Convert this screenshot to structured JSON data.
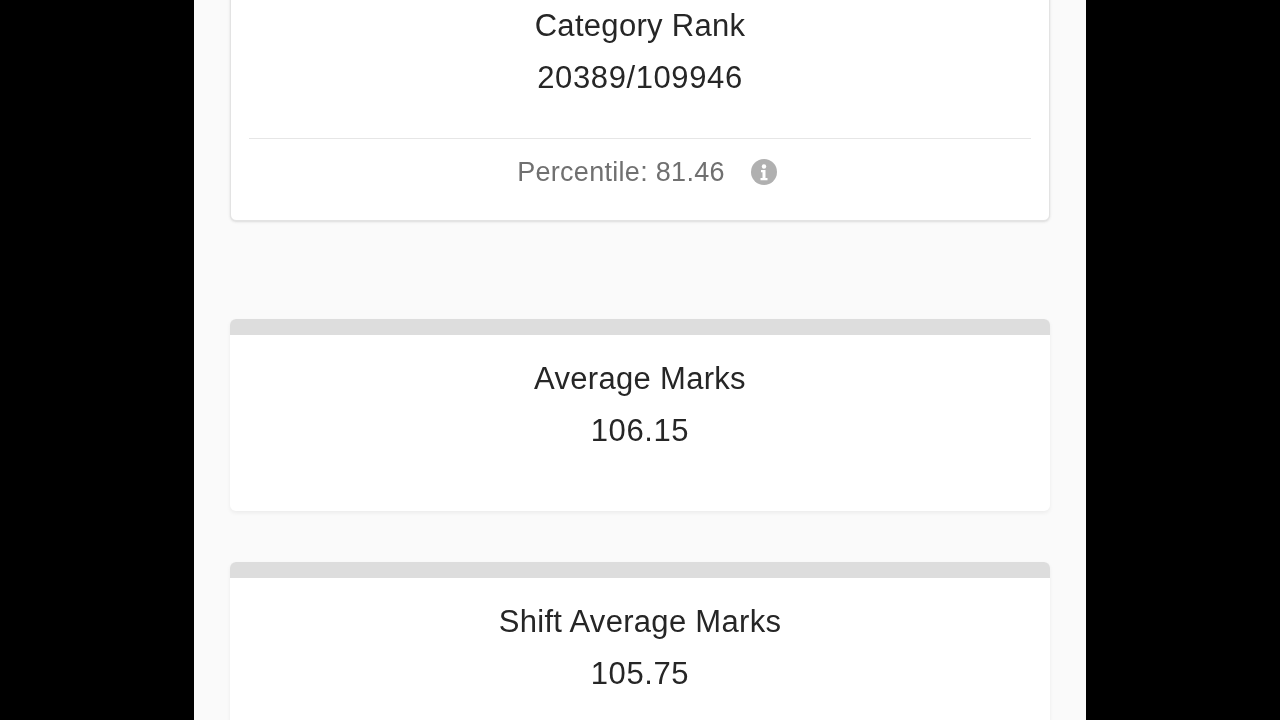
{
  "rank_card": {
    "title": "Category Rank",
    "value": "20389/109946",
    "percentile": "Percentile: 81.46"
  },
  "stat_cards": [
    {
      "title": "Average Marks",
      "value": "106.15"
    },
    {
      "title": "Shift Average Marks",
      "value": "105.75"
    }
  ]
}
